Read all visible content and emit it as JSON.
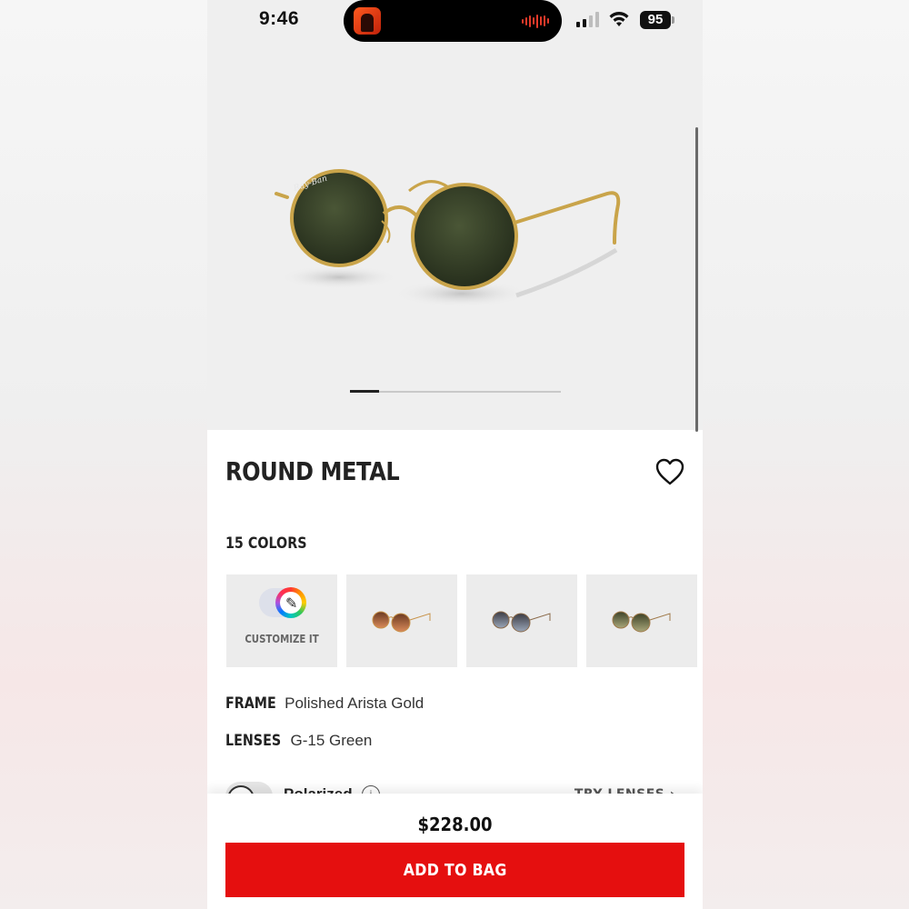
{
  "status_bar": {
    "time": "9:46",
    "battery": "95"
  },
  "product": {
    "title": "ROUND METAL",
    "colors_count": "15 COLORS",
    "customize_label": "CUSTOMIZE IT",
    "specs": [
      {
        "key": "FRAME",
        "value": "Polished Arista Gold"
      },
      {
        "key": "LENSES",
        "value": "G-15 Green"
      }
    ],
    "polarized_label": "Polarized",
    "try_lenses_label": "TRY LENSES",
    "price": "$228.00",
    "add_to_bag_label": "ADD TO BAG"
  },
  "carousel": {
    "current": 1,
    "total": 7
  },
  "colors": {
    "accent_red": "#e50f0f",
    "lens_green": "#2f3a25",
    "frame_gold": "#c9a44a"
  }
}
